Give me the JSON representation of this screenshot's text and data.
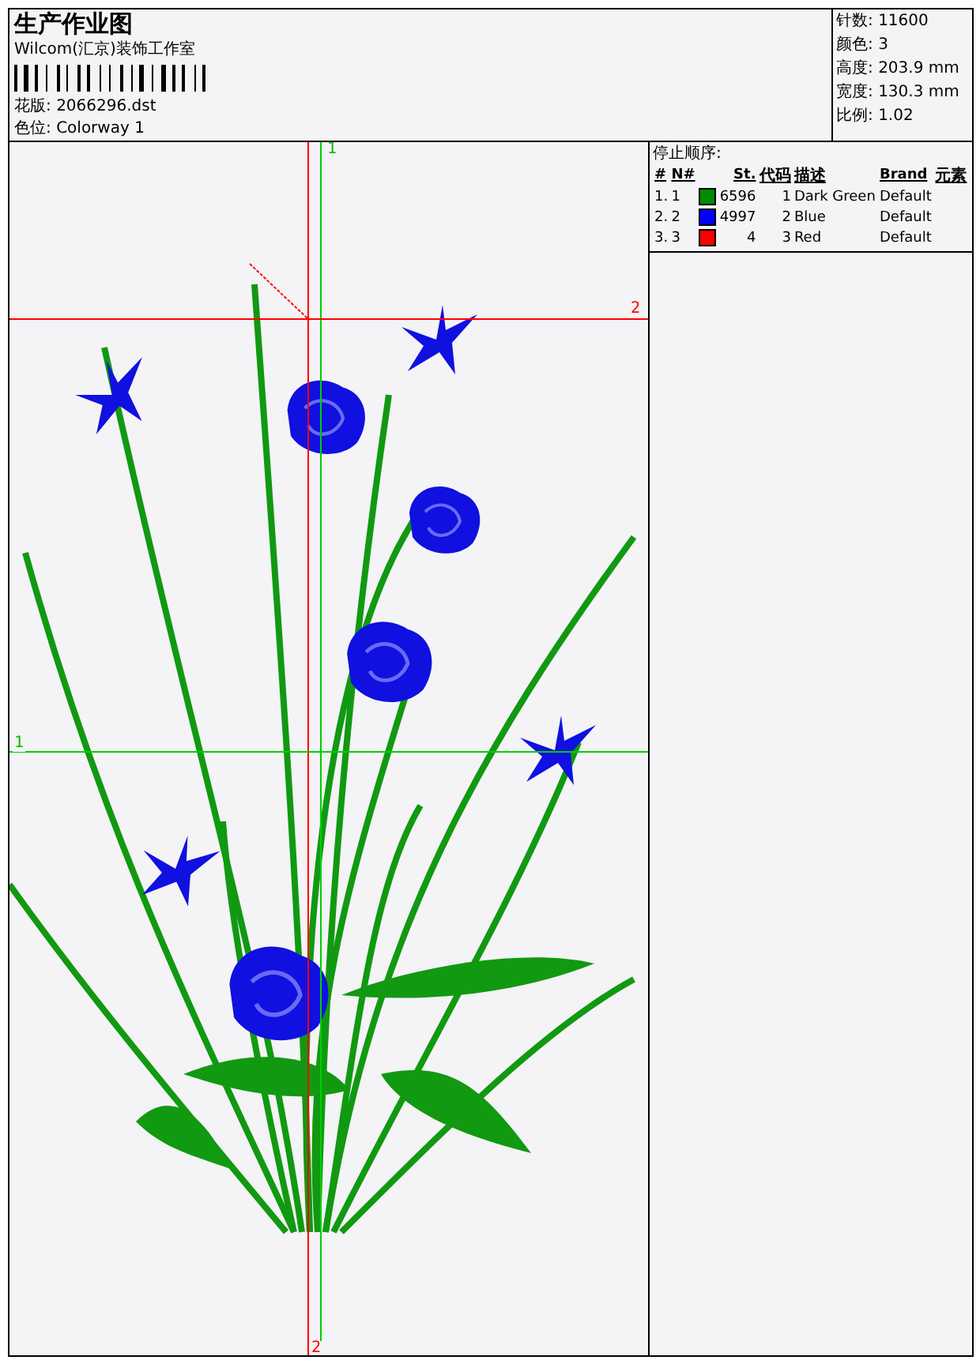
{
  "header": {
    "title": "生产作业图",
    "company": "Wilcom(汇京)装饰工作室",
    "design": {
      "label": "花版:",
      "value": "2066296.dst"
    },
    "colorway": {
      "label": "色位:",
      "value": "Colorway 1"
    }
  },
  "info": [
    {
      "label": "针数:",
      "value": "11600"
    },
    {
      "label": "颜色:",
      "value": "3"
    },
    {
      "label": "高度:",
      "value": "203.9 mm"
    },
    {
      "label": "宽度:",
      "value": "130.3 mm"
    },
    {
      "label": "比例:",
      "value": "1.02"
    }
  ],
  "canvas": {
    "markers": [
      {
        "label": "1",
        "kind": "vertical-top",
        "color": "#00c000"
      },
      {
        "label": "2",
        "kind": "horizontal-right",
        "color": "#ff0000"
      },
      {
        "label": "1",
        "kind": "horizontal-left",
        "color": "#00c000"
      },
      {
        "label": "2",
        "kind": "vertical-bottom",
        "color": "#ff0000"
      }
    ]
  },
  "stop_sequence": {
    "title": "停止顺序:",
    "columns": [
      "#",
      "N#",
      "St.",
      "代码",
      "描述",
      "Brand",
      "元素"
    ],
    "rows": [
      {
        "index": "1.",
        "number": "1",
        "color": "#008c00",
        "stitches": "6596",
        "code": "1",
        "description": "Dark Green",
        "brand": "Default"
      },
      {
        "index": "2.",
        "number": "2",
        "color": "#0000ff",
        "stitches": "4997",
        "code": "2",
        "description": "Blue",
        "brand": "Default"
      },
      {
        "index": "3.",
        "number": "3",
        "color": "#ff0000",
        "stitches": "4",
        "code": "3",
        "description": "Red",
        "brand": "Default"
      }
    ]
  }
}
